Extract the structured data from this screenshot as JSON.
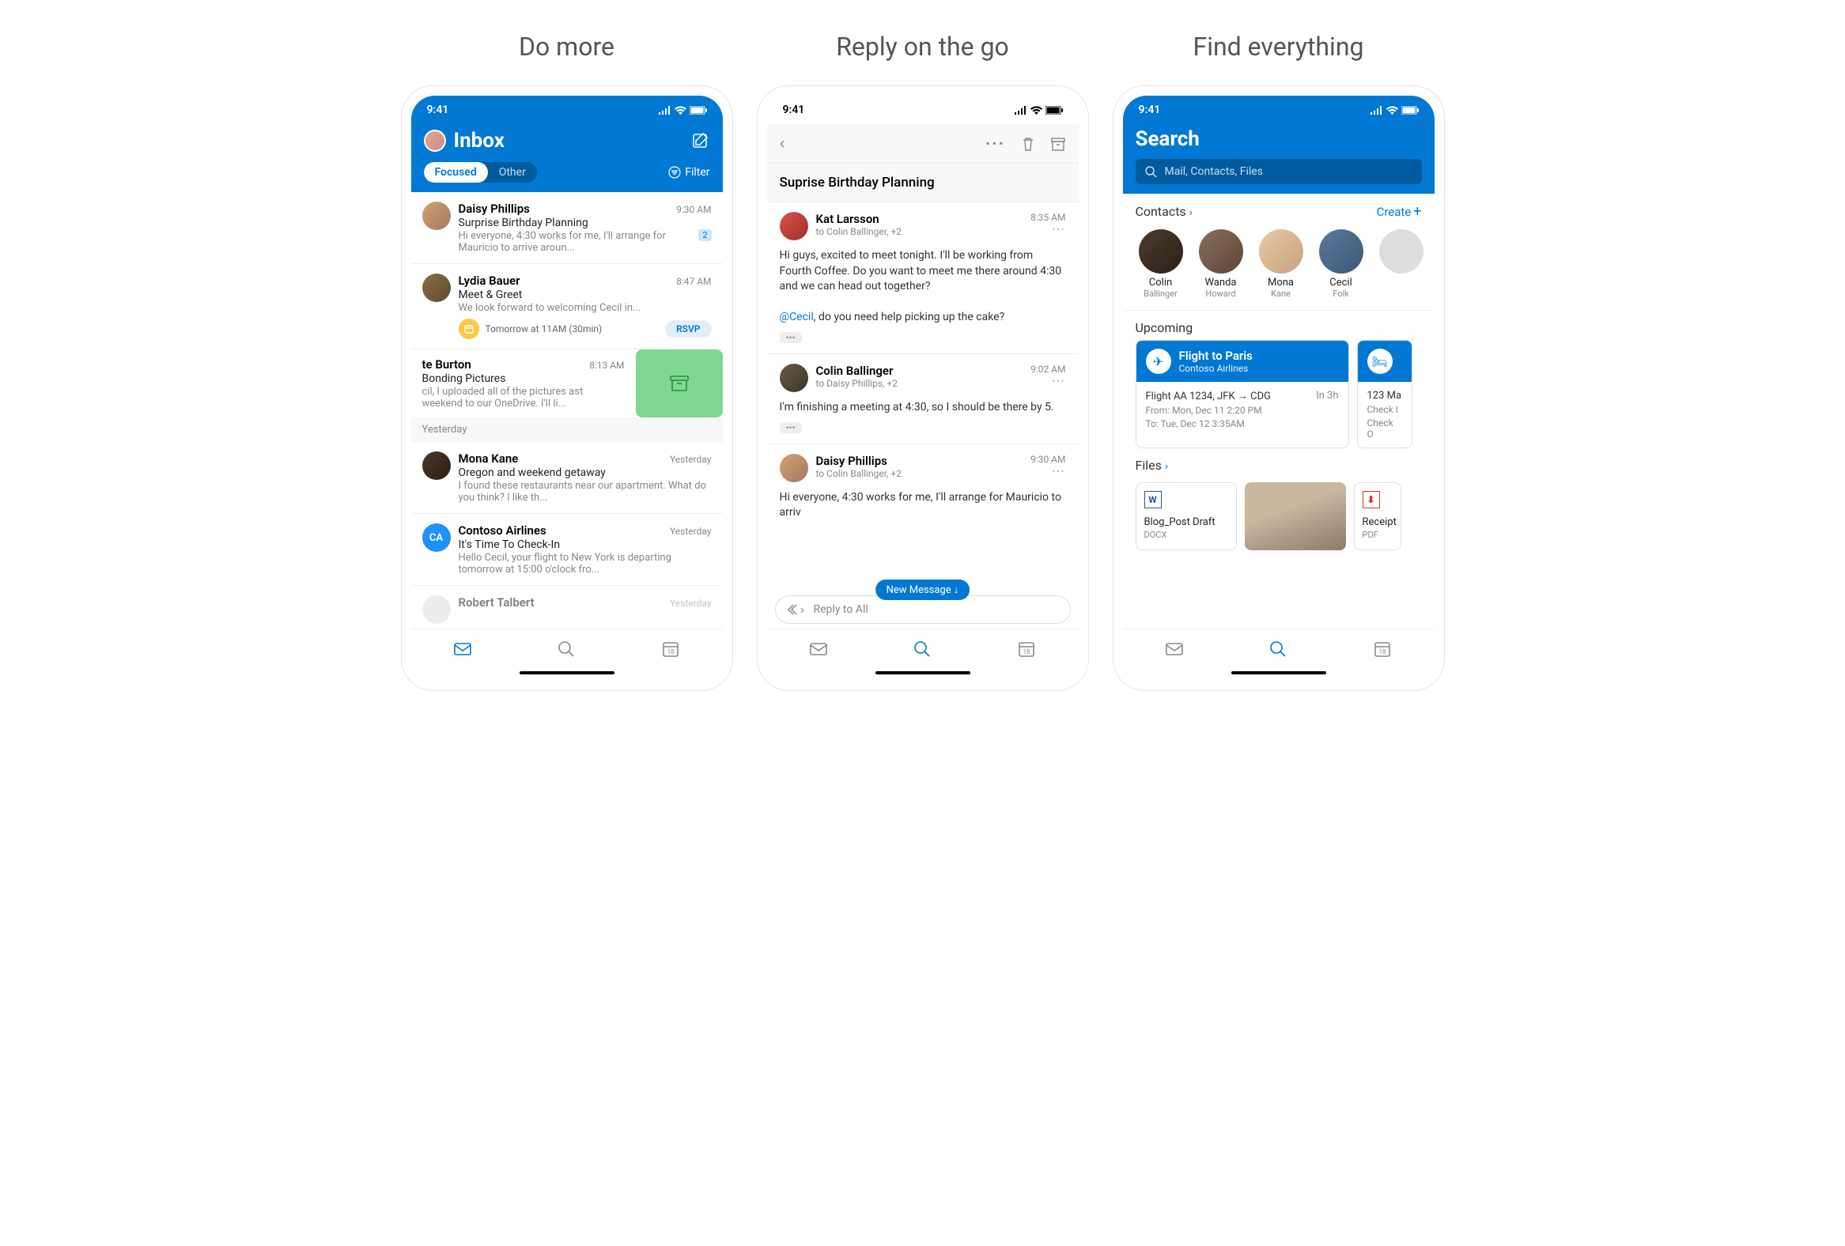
{
  "panel1": {
    "title": "Do more"
  },
  "panel2": {
    "title": "Reply on the go"
  },
  "panel3": {
    "title": "Find everything"
  },
  "time": "9:41",
  "inbox": {
    "title": "Inbox",
    "tabs": {
      "focused": "Focused",
      "other": "Other"
    },
    "filter": "Filter",
    "sectionYesterday": "Yesterday",
    "emails": [
      {
        "sender": "Daisy Phillips",
        "time": "9:30 AM",
        "subject": "Surprise Birthday Planning",
        "preview": "Hi everyone, 4:30 works for me, I'll arrange for Mauricio to arrive aroun...",
        "badge": "2"
      },
      {
        "sender": "Lydia Bauer",
        "time": "8:47 AM",
        "subject": "Meet & Greet",
        "preview": "We look forward to welcoming Cecil in...",
        "calText": "Tomorrow at 11AM (30min)",
        "rsvp": "RSVP"
      }
    ],
    "swiped": {
      "sender": "te Burton",
      "time": "8:13 AM",
      "subject": "Bonding Pictures",
      "preview": "cil, I uploaded all of the pictures ast weekend to our OneDrive. I'll li..."
    },
    "yesterday": [
      {
        "sender": "Mona Kane",
        "time": "Yesterday",
        "subject": "Oregon and weekend getaway",
        "preview": "I found these restaurants near our apartment. What do you think? I like th..."
      },
      {
        "sender": "Contoso Airlines",
        "initials": "CA",
        "time": "Yesterday",
        "subject": "It's Time To Check-In",
        "preview": "Hello Cecil, your flight to New York is departing tomorrow at 15:00 o'clock fro..."
      },
      {
        "sender": "Robert Talbert",
        "time": "Yesterday"
      }
    ]
  },
  "thread": {
    "subject": "Suprise Birthday Planning",
    "newMsg": "New Message ↓",
    "replyAll": "Reply to All",
    "msgs": [
      {
        "from": "Kat Larsson",
        "to": "to Colin Ballinger, +2",
        "time": "8:35 AM",
        "body1": "Hi guys, excited to meet tonight. I'll be working from Fourth Coffee. Do you want to meet me there around 4:30 and we can head out together?",
        "mention": "@Cecil",
        "body2": ", do you need help picking up the cake?"
      },
      {
        "from": "Colin Ballinger",
        "to": "to Daisy Phillips, +2",
        "time": "9:02 AM",
        "body1": "I'm finishing a meeting at 4:30, so I should be there by 5."
      },
      {
        "from": "Daisy Phillips",
        "to": "to Colin Ballinger, +2",
        "time": "9:30 AM",
        "body1": "Hi everyone, 4:30 works for me, I'll arrange for Mauricio to arriv"
      }
    ]
  },
  "search": {
    "title": "Search",
    "placeholder": "Mail, Contacts, Files",
    "contactsLabel": "Contacts",
    "createLabel": "Create",
    "upcomingLabel": "Upcoming",
    "filesLabel": "Files",
    "contacts": [
      {
        "first": "Colin",
        "last": "Ballinger"
      },
      {
        "first": "Wanda",
        "last": "Howard"
      },
      {
        "first": "Mona",
        "last": "Kane"
      },
      {
        "first": "Cecil",
        "last": "Folk"
      }
    ],
    "flight": {
      "title": "Flight to Paris",
      "airline": "Contoso Airlines",
      "route": "Flight AA 1234, JFK → CDG",
      "eta": "In 3h",
      "from": "From: Mon, Dec 11 2:20 PM",
      "to": "To: Tue, Dec 12 3:35AM"
    },
    "card2": {
      "line1": "123 Ma",
      "line2": "Check I",
      "line3": "Check O"
    },
    "files": [
      {
        "name": "Blog_Post Draft",
        "type": "DOCX",
        "kind": "word",
        "letter": "W"
      },
      {
        "name": "Receipt",
        "type": "PDF",
        "kind": "pdf",
        "letter": "⬇"
      }
    ]
  },
  "calDay": "18"
}
